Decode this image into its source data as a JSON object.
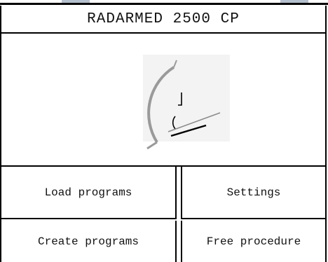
{
  "header": {
    "title": "RADARMED 2500 CP"
  },
  "menu": {
    "load_programs": "Load programs",
    "settings": "Settings",
    "create_programs": "Create programs",
    "free_procedure": "Free procedure"
  },
  "logo": {
    "icon": "radar-device-logo-icon"
  },
  "colors": {
    "border": "#000000",
    "background": "#ffffff",
    "logo_gray": "#9a9a9a"
  }
}
